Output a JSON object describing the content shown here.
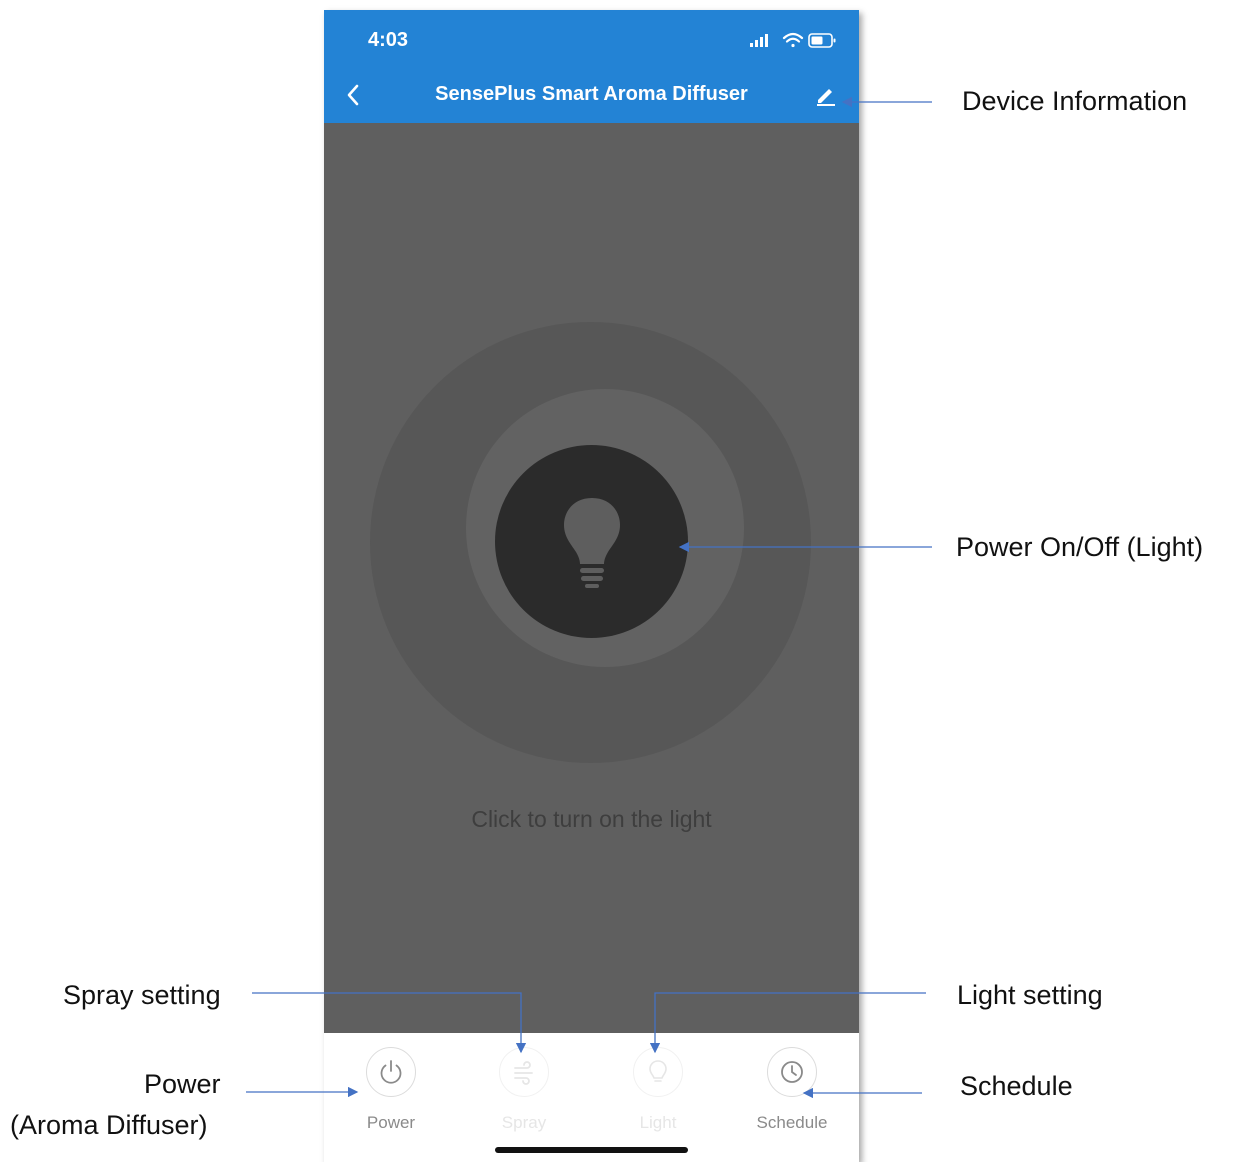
{
  "status_bar": {
    "time": "4:03"
  },
  "header": {
    "title": "SensePlus Smart Aroma Diffuser"
  },
  "main": {
    "hint": "Click to turn on the light"
  },
  "tabs": [
    {
      "label": "Power",
      "icon": "power-icon",
      "enabled": true
    },
    {
      "label": "Spray",
      "icon": "spray-icon",
      "enabled": false
    },
    {
      "label": "Light",
      "icon": "bulb-icon",
      "enabled": false
    },
    {
      "label": "Schedule",
      "icon": "clock-icon",
      "enabled": true
    }
  ],
  "annotations": {
    "device_info": "Device Information",
    "power_light": "Power On/Off (Light)",
    "spray_setting": "Spray setting",
    "light_setting": "Light setting",
    "power_line1": "Power",
    "power_line2": "(Aroma Diffuser)",
    "schedule": "Schedule"
  },
  "colors": {
    "header": "#2383d5",
    "background": "#5f5f5f",
    "arrow": "#4472c4"
  }
}
